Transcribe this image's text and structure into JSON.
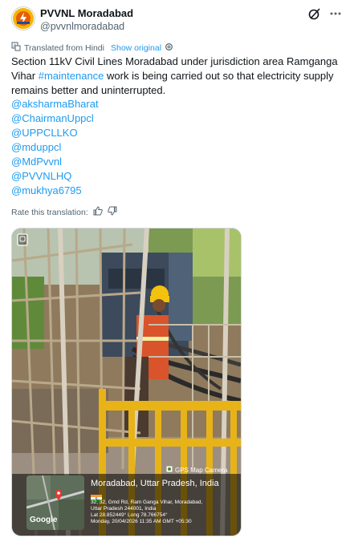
{
  "author": {
    "name": "PVVNL Moradabad",
    "handle": "@pvvnlmoradabad"
  },
  "translation": {
    "note": "Translated from Hindi",
    "show_original": "Show original"
  },
  "tweet": {
    "text_before": "Section 11kV Civil Lines Moradabad under jurisdiction area Ramganga Vihar ",
    "hashtag": "#maintenance",
    "text_after": " work is being carried out so that electricity supply remains better and uninterrupted.",
    "mentions": [
      "@aksharmaBharat",
      "@ChairmanUppcl",
      "@UPPCLLKO",
      "@mduppcl",
      "@MdPvvnl",
      "@PVVNLHQ",
      "@mukhya6795"
    ]
  },
  "rate": {
    "label": "Rate this translation:"
  },
  "photo": {
    "gps_label": "GPS Map Camera",
    "google": "Google",
    "city": "Moradabad, Uttar Pradesh, India",
    "address_line1": "32, 32, Gmd Rd, Ram Ganga Vihar, Moradabad,",
    "address_line2": "Uttar Pradesh 244001, India",
    "coords": "Lat 28.852449° Long 78.766754°",
    "datetime": "Monday, 20/04/2026 11:35 AM GMT +05:30"
  },
  "icons": {
    "grok": "grok-icon",
    "more": "more-dots-icon",
    "gear": "gear-icon",
    "translate": "translate-icon",
    "thumbs_up": "thumbs-up-icon",
    "thumbs_down": "thumbs-down-icon",
    "alt": "image-alt-icon",
    "location": "location-pin-icon"
  },
  "colors": {
    "link": "#1d9bf0",
    "text": "#0f1419",
    "muted": "#536471"
  }
}
